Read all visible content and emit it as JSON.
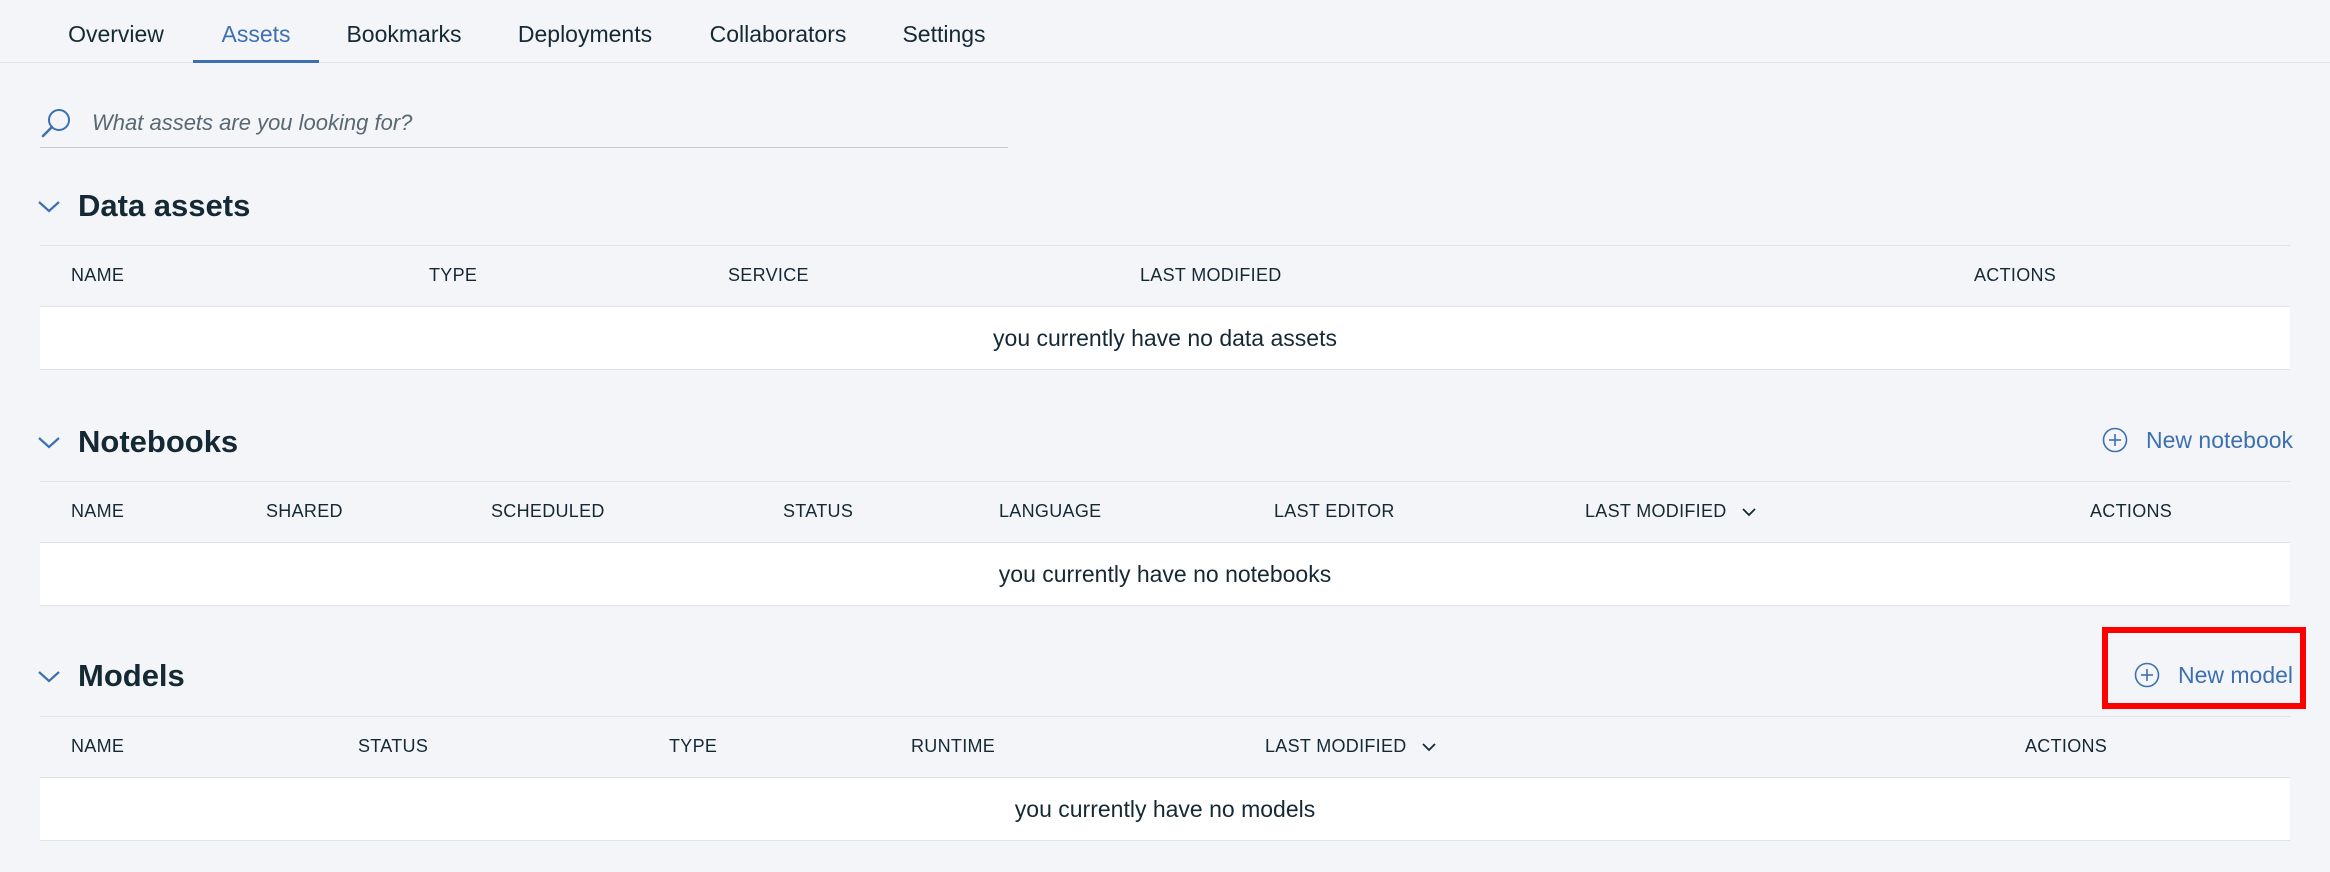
{
  "tabs": [
    {
      "label": "Overview"
    },
    {
      "label": "Assets"
    },
    {
      "label": "Bookmarks"
    },
    {
      "label": "Deployments"
    },
    {
      "label": "Collaborators"
    },
    {
      "label": "Settings"
    }
  ],
  "active_tab": "Assets",
  "search": {
    "placeholder": "What assets are you looking for?",
    "value": "",
    "icon": "search-icon"
  },
  "data_assets": {
    "title": "Data assets",
    "columns": [
      "NAME",
      "TYPE",
      "SERVICE",
      "LAST MODIFIED",
      "ACTIONS"
    ],
    "empty_text": "you currently have no data assets"
  },
  "notebooks": {
    "title": "Notebooks",
    "new_label": "New notebook",
    "columns": [
      "NAME",
      "SHARED",
      "SCHEDULED",
      "STATUS",
      "LANGUAGE",
      "LAST EDITOR",
      "LAST MODIFIED",
      "ACTIONS"
    ],
    "sorted_column": "LAST MODIFIED",
    "empty_text": "you currently have no notebooks"
  },
  "models": {
    "title": "Models",
    "new_label": "New model",
    "columns": [
      "NAME",
      "STATUS",
      "TYPE",
      "RUNTIME",
      "LAST MODIFIED",
      "ACTIONS"
    ],
    "sorted_column": "LAST MODIFIED",
    "empty_text": "you currently have no models"
  },
  "colors": {
    "accent": "#3d70b2",
    "text": "#152935",
    "background": "#f4f5f8",
    "highlight": "#ff0000"
  }
}
